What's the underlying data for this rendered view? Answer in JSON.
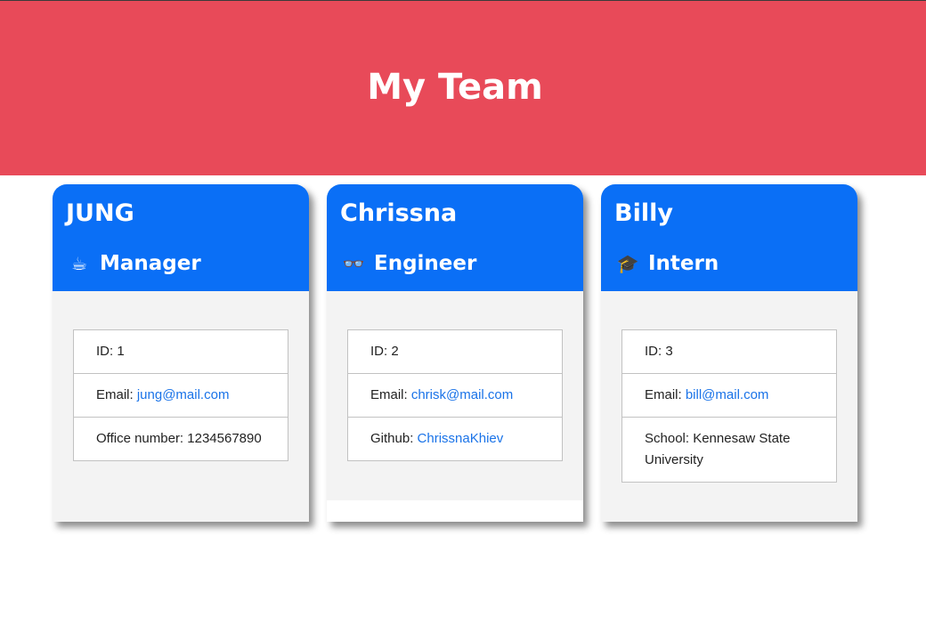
{
  "page": {
    "title": "My Team",
    "header_color": "#e84a59",
    "card_header_color": "#0a6ff6",
    "link_color": "#1a73e8"
  },
  "cards": [
    {
      "name": "JUNG",
      "role": "Manager",
      "role_icon": "coffee-cup-icon",
      "role_glyph": "☕",
      "id_text": "ID: 1",
      "email_label": "Email: ",
      "email": "jung@mail.com",
      "extra_label": "Office number: 1234567890"
    },
    {
      "name": "Chrissna",
      "role": "Engineer",
      "role_icon": "glasses-icon",
      "role_glyph": "👓",
      "id_text": "ID: 2",
      "email_label": "Email: ",
      "email": "chrisk@mail.com",
      "extra_label": "Github: ",
      "extra_link": "ChrissnaKhiev"
    },
    {
      "name": "Billy",
      "role": "Intern",
      "role_icon": "graduation-cap-icon",
      "role_glyph": "🎓",
      "id_text": "ID: 3",
      "email_label": "Email: ",
      "email": "bill@mail.com",
      "extra_label": "School: Kennesaw State University"
    }
  ]
}
